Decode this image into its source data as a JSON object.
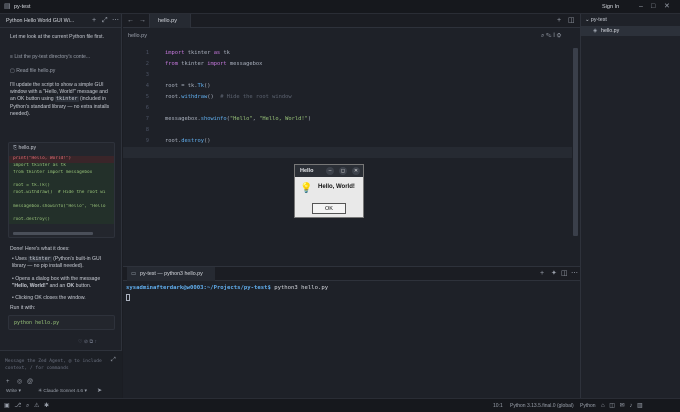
{
  "app": {
    "project": "py-test",
    "sign_in": "Sign In"
  },
  "left_panel": {
    "thread_title": "Python Hello World GUI Wi...",
    "msg1": "Let me look at the current Python file first.",
    "tool1": "List the py-test directory's conte...",
    "tool2": "Read file hello.py",
    "msg2a": "I'll update the script to show a simple GUI window with a \"Hello, World!\" message and an OK button using",
    "msg2b_code": "tkinter",
    "msg2c": "(included in Python's standard library — no extra installs needed).",
    "diff_file": "hello.py",
    "diff_lines": [
      {
        "t": "print(\"Hello, World!\")",
        "kind": "del"
      },
      {
        "t": "import tkinter as tk",
        "kind": "add"
      },
      {
        "t": "from tkinter import messagebox",
        "kind": "add"
      },
      {
        "t": "",
        "kind": "add"
      },
      {
        "t": "root = tk.Tk()",
        "kind": "add"
      },
      {
        "t": "root.withdraw()  # Hide the root wi",
        "kind": "add"
      },
      {
        "t": "",
        "kind": "add"
      },
      {
        "t": "messagebox.showinfo(\"Hello\", \"Hello",
        "kind": "add"
      },
      {
        "t": "",
        "kind": "add"
      },
      {
        "t": "root.destroy()",
        "kind": "add"
      }
    ],
    "done": "Done! Here's what it does:",
    "bullets": [
      "Uses tkinter (Python's built-in GUI library — no pip install needed).",
      "Opens a dialog box with the message \"Hello, World!\" and an OK button.",
      "Clicking OK closes the window."
    ],
    "run_with": "Run it with:",
    "run_cmd": "python hello.py",
    "input_placeholder": "Message the Zed Agent, @ to include context, / for commands",
    "mode": "Write",
    "model": "Claude Sonnet 4.6"
  },
  "editor": {
    "tab": "hello.py",
    "breadcrumb": "hello.py",
    "lines": [
      {
        "n": "1",
        "code": [
          [
            "kw",
            "import "
          ],
          [
            "pl",
            "tkinter "
          ],
          [
            "kw",
            "as "
          ],
          [
            "pl",
            "tk"
          ]
        ]
      },
      {
        "n": "2",
        "code": [
          [
            "kw",
            "from "
          ],
          [
            "pl",
            "tkinter "
          ],
          [
            "kw",
            "import "
          ],
          [
            "pl",
            "messagebox"
          ]
        ]
      },
      {
        "n": "3",
        "code": []
      },
      {
        "n": "4",
        "code": [
          [
            "pl",
            "root = tk."
          ],
          [
            "fn",
            "Tk"
          ],
          [
            "pl",
            "()"
          ]
        ]
      },
      {
        "n": "5",
        "code": [
          [
            "pl",
            "root."
          ],
          [
            "fn",
            "withdraw"
          ],
          [
            "pl",
            "()  "
          ],
          [
            "cm",
            "# Hide the root window"
          ]
        ]
      },
      {
        "n": "6",
        "code": []
      },
      {
        "n": "7",
        "code": [
          [
            "pl",
            "messagebox."
          ],
          [
            "fn",
            "showinfo"
          ],
          [
            "pl",
            "("
          ],
          [
            "str",
            "\"Hello\""
          ],
          [
            "pl",
            ", "
          ],
          [
            "str",
            "\"Hello, World!\""
          ],
          [
            "pl",
            ")"
          ]
        ]
      },
      {
        "n": "8",
        "code": []
      },
      {
        "n": "9",
        "code": [
          [
            "pl",
            "root."
          ],
          [
            "fn",
            "destroy"
          ],
          [
            "pl",
            "()"
          ]
        ]
      },
      {
        "n": "10",
        "code": []
      }
    ]
  },
  "terminal": {
    "tab": "py-test — python3 hello.py",
    "prompt_user": "sysadminafterdark@w0003",
    "prompt_path": ":~/Projects/py-test$",
    "command": " python3 hello.py"
  },
  "dialog": {
    "title": "Hello",
    "message": "Hello, World!",
    "ok": "OK"
  },
  "project_panel": {
    "root": "py-test",
    "file": "hello.py"
  },
  "status": {
    "position": "10:1",
    "interpreter": "Python 3.13.5.final.0 (global)",
    "language": "Python"
  }
}
